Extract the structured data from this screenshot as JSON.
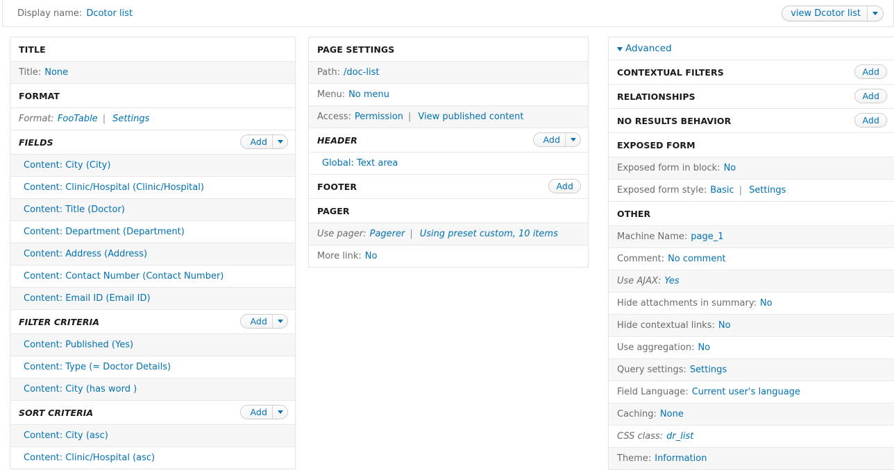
{
  "header": {
    "display_name_label": "Display name:",
    "display_name_value": "Dcotor list",
    "view_button_label": "view Dcotor list"
  },
  "labels": {
    "add": "Add"
  },
  "left_column": {
    "sections": [
      {
        "title": "TITLE",
        "italic": false,
        "add": null,
        "rows": [
          {
            "label": "Title:",
            "links": [
              "None"
            ],
            "alt": true,
            "italic": false,
            "indent": false
          }
        ]
      },
      {
        "title": "FORMAT",
        "italic": false,
        "add": null,
        "rows": [
          {
            "label": "Format:",
            "links": [
              "FooTable",
              "Settings"
            ],
            "alt": false,
            "italic": true,
            "indent": false
          }
        ]
      },
      {
        "title": "FIELDS",
        "italic": true,
        "add": "dropdown",
        "rows": [
          {
            "label": "",
            "links": [
              "Content: City (City)"
            ],
            "alt": true,
            "italic": false,
            "indent": true
          },
          {
            "label": "",
            "links": [
              "Content: Clinic/Hospital (Clinic/Hospital)"
            ],
            "alt": false,
            "italic": false,
            "indent": true
          },
          {
            "label": "",
            "links": [
              "Content: Title (Doctor)"
            ],
            "alt": true,
            "italic": false,
            "indent": true
          },
          {
            "label": "",
            "links": [
              "Content: Department (Department)"
            ],
            "alt": false,
            "italic": false,
            "indent": true
          },
          {
            "label": "",
            "links": [
              "Content: Address (Address)"
            ],
            "alt": true,
            "italic": false,
            "indent": true
          },
          {
            "label": "",
            "links": [
              "Content: Contact Number (Contact Number)"
            ],
            "alt": false,
            "italic": false,
            "indent": true
          },
          {
            "label": "",
            "links": [
              "Content: Email ID (Email ID)"
            ],
            "alt": true,
            "italic": false,
            "indent": true
          }
        ]
      },
      {
        "title": "FILTER CRITERIA",
        "italic": true,
        "add": "dropdown",
        "rows": [
          {
            "label": "",
            "links": [
              "Content: Published (Yes)"
            ],
            "alt": true,
            "italic": false,
            "indent": true
          },
          {
            "label": "",
            "links": [
              "Content: Type (= Doctor Details)"
            ],
            "alt": false,
            "italic": false,
            "indent": true
          },
          {
            "label": "",
            "links": [
              "Content: City (has word )"
            ],
            "alt": true,
            "italic": false,
            "indent": true
          }
        ]
      },
      {
        "title": "SORT CRITERIA",
        "italic": true,
        "add": "dropdown",
        "rows": [
          {
            "label": "",
            "links": [
              "Content: City (asc)"
            ],
            "alt": true,
            "italic": false,
            "indent": true
          },
          {
            "label": "",
            "links": [
              "Content: Clinic/Hospital (asc)"
            ],
            "alt": false,
            "italic": false,
            "indent": true
          }
        ]
      }
    ]
  },
  "middle_column": {
    "sections": [
      {
        "title": "PAGE SETTINGS",
        "italic": false,
        "add": null,
        "rows": [
          {
            "label": "Path:",
            "links": [
              "/doc-list"
            ],
            "alt": true,
            "italic": false,
            "indent": false
          },
          {
            "label": "Menu:",
            "links": [
              "No menu"
            ],
            "alt": false,
            "italic": false,
            "indent": false
          },
          {
            "label": "Access:",
            "links": [
              "Permission",
              "View published content"
            ],
            "alt": true,
            "italic": false,
            "indent": false
          }
        ]
      },
      {
        "title": "HEADER",
        "italic": true,
        "add": "dropdown",
        "rows": [
          {
            "label": "",
            "links": [
              "Global: Text area"
            ],
            "alt": false,
            "italic": false,
            "indent": true
          }
        ]
      },
      {
        "title": "FOOTER",
        "italic": false,
        "add": "plain",
        "rows": []
      },
      {
        "title": "PAGER",
        "italic": false,
        "add": null,
        "rows": [
          {
            "label": "Use pager:",
            "links": [
              "Pagerer",
              "Using preset custom, 10 items"
            ],
            "alt": true,
            "italic": true,
            "indent": false
          },
          {
            "label": "More link:",
            "links": [
              "No"
            ],
            "alt": false,
            "italic": false,
            "indent": false
          }
        ]
      }
    ]
  },
  "right_column": {
    "advanced_label": "Advanced",
    "sections": [
      {
        "title": "CONTEXTUAL FILTERS",
        "italic": false,
        "add": "plain",
        "rows": []
      },
      {
        "title": "RELATIONSHIPS",
        "italic": false,
        "add": "plain",
        "rows": []
      },
      {
        "title": "NO RESULTS BEHAVIOR",
        "italic": false,
        "add": "plain",
        "rows": []
      },
      {
        "title": "EXPOSED FORM",
        "italic": false,
        "add": null,
        "rows": [
          {
            "label": "Exposed form in block:",
            "links": [
              "No"
            ],
            "alt": true,
            "italic": false,
            "indent": false
          },
          {
            "label": "Exposed form style:",
            "links": [
              "Basic",
              "Settings"
            ],
            "alt": false,
            "italic": false,
            "indent": false
          }
        ]
      },
      {
        "title": "OTHER",
        "italic": false,
        "add": null,
        "rows": [
          {
            "label": "Machine Name:",
            "links": [
              "page_1"
            ],
            "alt": true,
            "italic": false,
            "indent": false
          },
          {
            "label": "Comment:",
            "links": [
              "No comment"
            ],
            "alt": false,
            "italic": false,
            "indent": false
          },
          {
            "label": "Use AJAX:",
            "links": [
              "Yes"
            ],
            "alt": true,
            "italic": true,
            "indent": false
          },
          {
            "label": "Hide attachments in summary:",
            "links": [
              "No"
            ],
            "alt": false,
            "italic": false,
            "indent": false
          },
          {
            "label": "Hide contextual links:",
            "links": [
              "No"
            ],
            "alt": true,
            "italic": false,
            "indent": false
          },
          {
            "label": "Use aggregation:",
            "links": [
              "No"
            ],
            "alt": false,
            "italic": false,
            "indent": false
          },
          {
            "label": "Query settings:",
            "links": [
              "Settings"
            ],
            "alt": true,
            "italic": false,
            "indent": false
          },
          {
            "label": "Field Language:",
            "links": [
              "Current user's language"
            ],
            "alt": false,
            "italic": false,
            "indent": false
          },
          {
            "label": "Caching:",
            "links": [
              "None"
            ],
            "alt": true,
            "italic": false,
            "indent": false
          },
          {
            "label": "CSS class:",
            "links": [
              "dr_list"
            ],
            "alt": false,
            "italic": true,
            "indent": false
          },
          {
            "label": "Theme:",
            "links": [
              "Information"
            ],
            "alt": true,
            "italic": false,
            "indent": false
          }
        ]
      }
    ]
  }
}
